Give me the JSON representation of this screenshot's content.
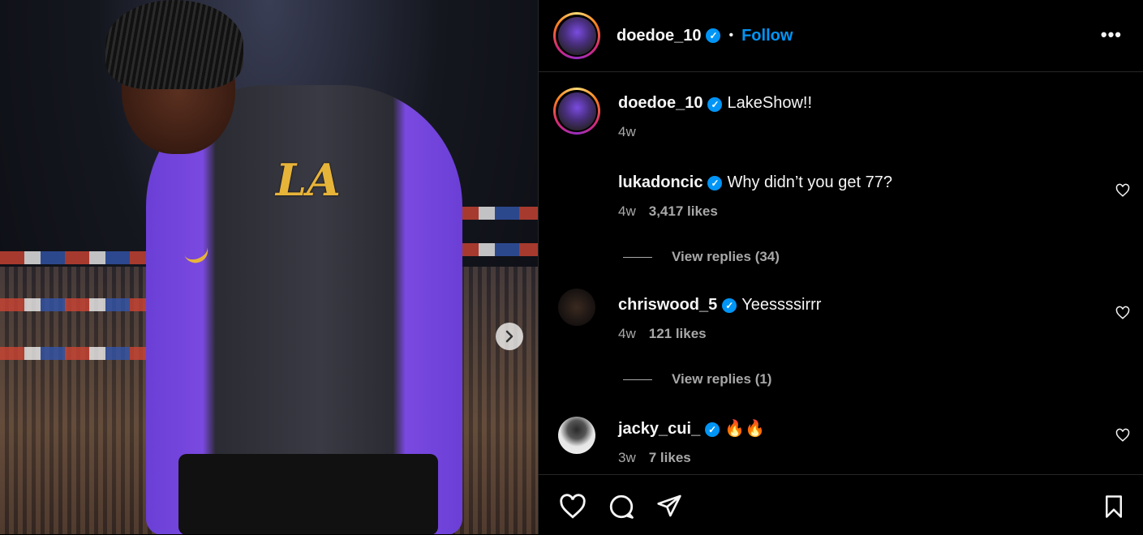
{
  "post": {
    "username": "doedoe_10",
    "follow_label": "Follow",
    "separator": "•",
    "more_label": "•••",
    "caption": "LakeShow!!",
    "caption_time": "4w",
    "photo_logo_text": "LA"
  },
  "comments": [
    {
      "username": "lukadoncic",
      "text": "Why didn’t you get 77?",
      "time": "4w",
      "likes": "3,417 likes",
      "replies": "View replies (34)"
    },
    {
      "username": "chriswood_5",
      "text": "Yeessssirrr",
      "time": "4w",
      "likes": "121 likes",
      "replies": "View replies (1)"
    },
    {
      "username": "jacky_cui_",
      "text": "🔥🔥",
      "time": "3w",
      "likes": "7 likes"
    }
  ],
  "icons": {
    "verified": "verified-badge-icon",
    "like": "heart-icon",
    "comment": "comment-bubble-icon",
    "share": "paper-plane-icon",
    "save": "bookmark-icon",
    "next": "chevron-right-icon"
  },
  "colors": {
    "accent": "#0095f6",
    "secondary_text": "#a8a8a8",
    "background": "#000000",
    "divider": "#262626"
  }
}
